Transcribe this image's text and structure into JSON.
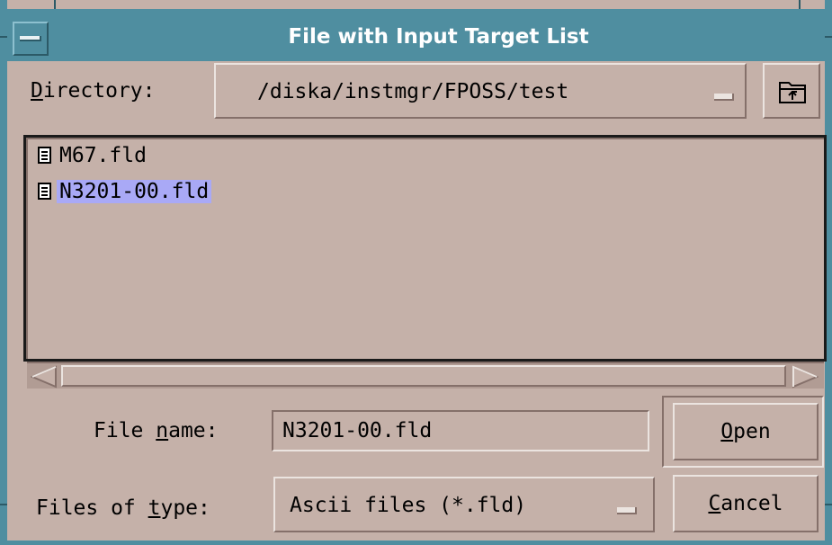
{
  "window": {
    "title": "File with Input Target List"
  },
  "directory": {
    "label": "Directory:",
    "label_mnemonic": "D",
    "value": "/diska/instmgr/FPOSS/test"
  },
  "files": [
    {
      "name": "M67.fld",
      "selected": false
    },
    {
      "name": "N3201-00.fld",
      "selected": true
    }
  ],
  "file_name": {
    "label_pre": "File ",
    "label_mnemonic": "n",
    "label_post": "ame:",
    "value": "N3201-00.fld"
  },
  "file_type": {
    "label_pre": "Files of ",
    "label_mnemonic": "t",
    "label_post": "ype:",
    "value": "Ascii files (*.fld)"
  },
  "buttons": {
    "open_mnemonic": "O",
    "open_rest": "pen",
    "cancel_mnemonic": "C",
    "cancel_rest": "ancel"
  },
  "colors": {
    "background": "#c5b1a9",
    "frame": "#4f8ea0",
    "selection": "#a9a9f6"
  },
  "icons": [
    "window-menu-icon",
    "folder-up-icon",
    "document-icon",
    "scroll-left-arrow-icon",
    "scroll-right-arrow-icon",
    "dropdown-handle-icon"
  ]
}
